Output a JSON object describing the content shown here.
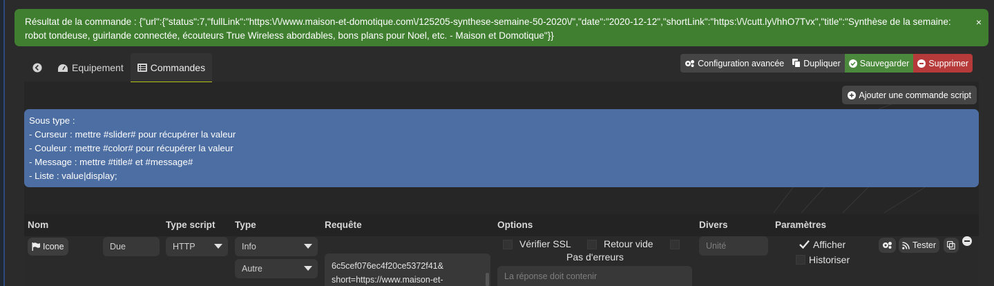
{
  "alert": {
    "message": "Résultat de la commande : {\"url\":{\"status\":7,\"fullLink\":\"https:\\/\\/www.maison-et-domotique.com\\/125205-synthese-semaine-50-2020\\/\",\"date\":\"2020-12-12\",\"shortLink\":\"https:\\/\\/cutt.ly\\/hhO7Tvx\",\"title\":\"Synthèse de la semaine: robot tondeuse, guirlande connectée, écouteurs True Wireless abordables, bons plans pour Noel, etc. - Maison et Domotique\"}}",
    "close_label": "×",
    "color": "#3f7f2f"
  },
  "tabs": [
    {
      "label": "",
      "icon": "back-arrow-icon"
    },
    {
      "label": "Equipement",
      "icon": "tachometer-icon"
    },
    {
      "label": "Commandes",
      "icon": "list-icon",
      "active": true
    }
  ],
  "actions": {
    "advanced_config": "Configuration avancée",
    "duplicate": "Dupliquer",
    "save": "Sauvegarder",
    "delete": "Supprimer",
    "add_script_command": "Ajouter une commande script"
  },
  "info": {
    "lines": [
      "Sous type :",
      "- Curseur : mettre #slider# pour récupérer la valeur",
      "- Couleur : mettre #color# pour récupérer la valeur",
      "- Message : mettre #title# et #message#",
      "- Liste : value|display;"
    ],
    "color": "#4d6ea3"
  },
  "table": {
    "headers": {
      "name": "Nom",
      "script_type": "Type script",
      "type": "Type",
      "request": "Requête",
      "options": "Options",
      "misc": "Divers",
      "params": "Paramètres"
    },
    "row": {
      "icon_button": "Icone",
      "name_value": "Due",
      "script_type_value": "HTTP",
      "type_value": "Info",
      "subtype_value": "Autre",
      "request_lines": [
        "6c5cef076ec4f20ce5372f41&",
        "short=https://www.maison-et-"
      ],
      "verify_ssl": "Vérifier SSL",
      "empty_return": "Retour vide",
      "no_errors": "Pas d'erreurs",
      "response_placeholder": "La réponse doit contenir",
      "unit_placeholder": "Unité",
      "show": "Afficher",
      "historize": "Historiser",
      "test": "Tester"
    }
  }
}
